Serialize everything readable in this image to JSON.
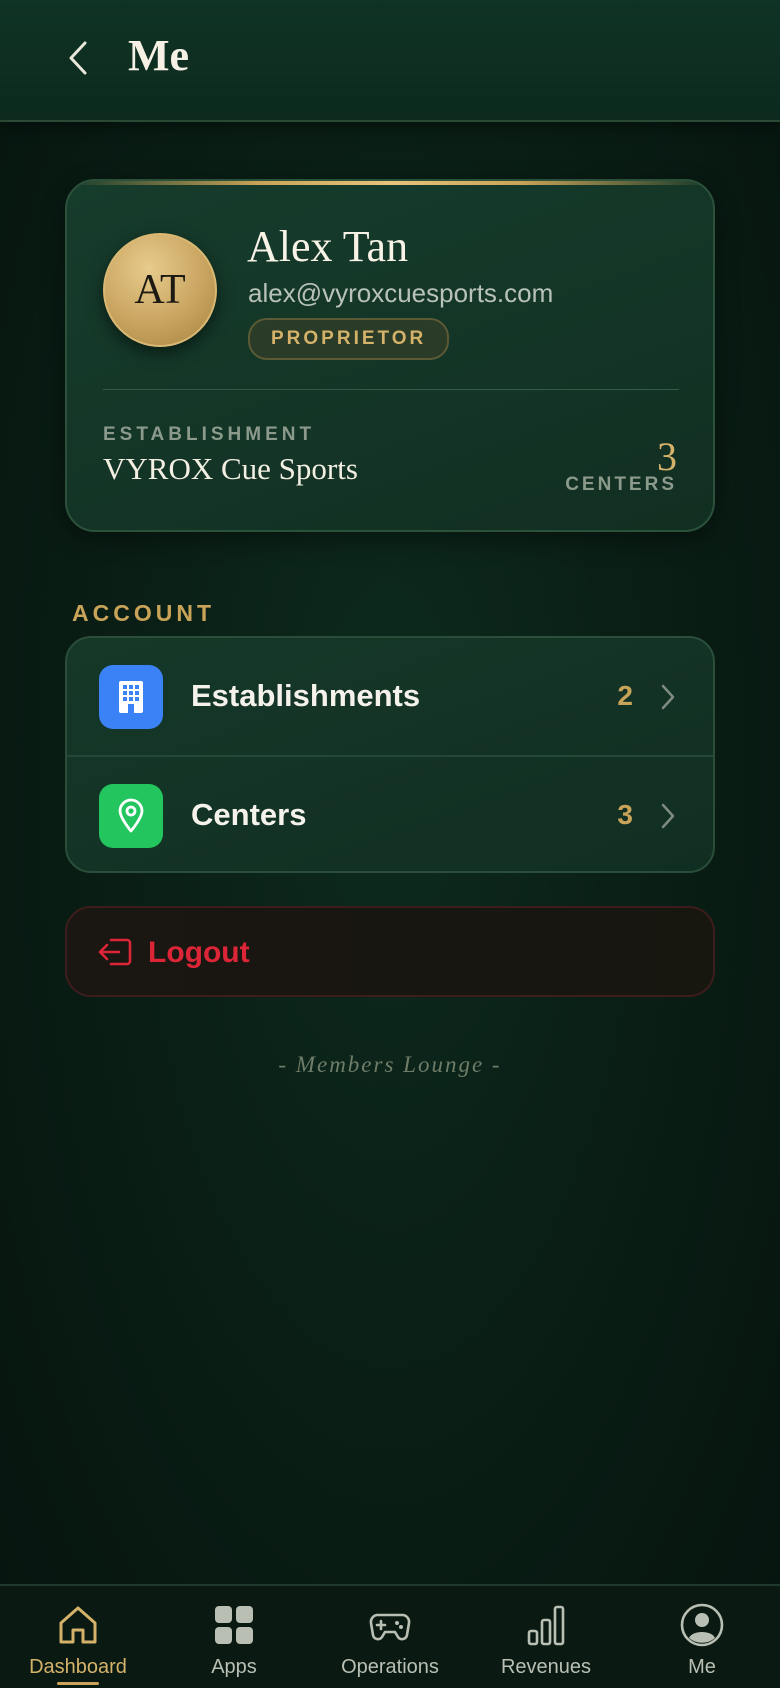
{
  "header": {
    "title": "Me",
    "back_icon": "chevron-left-icon"
  },
  "profile": {
    "initials": "AT",
    "name": "Alex Tan",
    "email": "alex@vyroxcuesports.com",
    "role": "PROPRIETOR",
    "establishment_label": "ESTABLISHMENT",
    "establishment_name": "VYROX Cue Sports",
    "centers_count": "3",
    "centers_label": "CENTERS"
  },
  "account": {
    "section_label": "ACCOUNT",
    "items": [
      {
        "label": "Establishments",
        "count": "2",
        "icon": "building-icon",
        "icon_color": "#3b82f6"
      },
      {
        "label": "Centers",
        "count": "3",
        "icon": "location-pin-icon",
        "icon_color": "#22c55e"
      }
    ]
  },
  "logout": {
    "label": "Logout",
    "icon": "logout-icon",
    "color": "#dc2638"
  },
  "footer_note": "- Members Lounge -",
  "bottom_nav": {
    "active": "Dashboard",
    "items": [
      {
        "label": "Dashboard",
        "icon": "home-icon"
      },
      {
        "label": "Apps",
        "icon": "grid-icon"
      },
      {
        "label": "Operations",
        "icon": "gamepad-icon"
      },
      {
        "label": "Revenues",
        "icon": "bar-chart-icon"
      },
      {
        "label": "Me",
        "icon": "user-circle-icon"
      }
    ]
  },
  "colors": {
    "accent_gold": "#c9a458",
    "background": "#0a1f16",
    "card": "#163c2c",
    "danger": "#dc2638"
  }
}
